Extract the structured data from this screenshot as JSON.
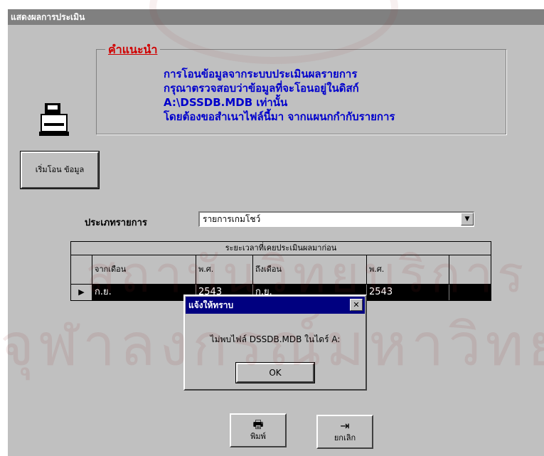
{
  "window": {
    "title": "แสดงผลการประเมิน"
  },
  "advice": {
    "heading": "คำแนะนำ",
    "lines": [
      "การโอนข้อมูลจากระบบประเมินผลรายการ",
      "กรุณาตรวจสอบว่าข้อมูลที่จะโอนอยู่ในดิสก์",
      "A:\\DSSDB.MDB เท่านั้น",
      "โดยต้องขอสำเนาไฟล์นี้มา จากแผนกกำกับรายการ"
    ]
  },
  "start_button": {
    "label": "เริ่มโอน ข้อมูล"
  },
  "program_type": {
    "label": "ประเภทรายการ",
    "selected": "รายการเกมโชว์"
  },
  "grid": {
    "caption": "ระยะเวลาที่เคยประเมินผลมาก่อน",
    "columns": [
      "จากเดือน",
      "พ.ศ.",
      "ถึงเดือน",
      "พ.ศ."
    ],
    "rows": [
      {
        "from_month": "ก.ย.",
        "from_year": "2543",
        "to_month": "ก.ย.",
        "to_year": "2543"
      }
    ]
  },
  "dialog": {
    "title": "แจ้งให้ทราบ",
    "message": "ไม่พบไฟล์ DSSDB.MDB ในไดร์ A:",
    "ok_label": "OK"
  },
  "footer": {
    "print_label": "พิมพ์",
    "cancel_label": "ยกเลิก"
  },
  "icons": {
    "printer": "printer-icon",
    "print": "print-icon",
    "exit": "exit-door-icon",
    "row": "row-pointer-icon",
    "dropdown": "dropdown-arrow-icon",
    "close": "close-icon"
  },
  "watermark": {
    "line1": "สถาบันวิทยบริการ",
    "line2": "จุฬาลงกรณ์มหาวิทยาลัย"
  },
  "colors": {
    "window": "#c0c0c0",
    "dialog_title": "#000080",
    "advice_text": "#0000cc",
    "advice_heading": "#d00000"
  }
}
